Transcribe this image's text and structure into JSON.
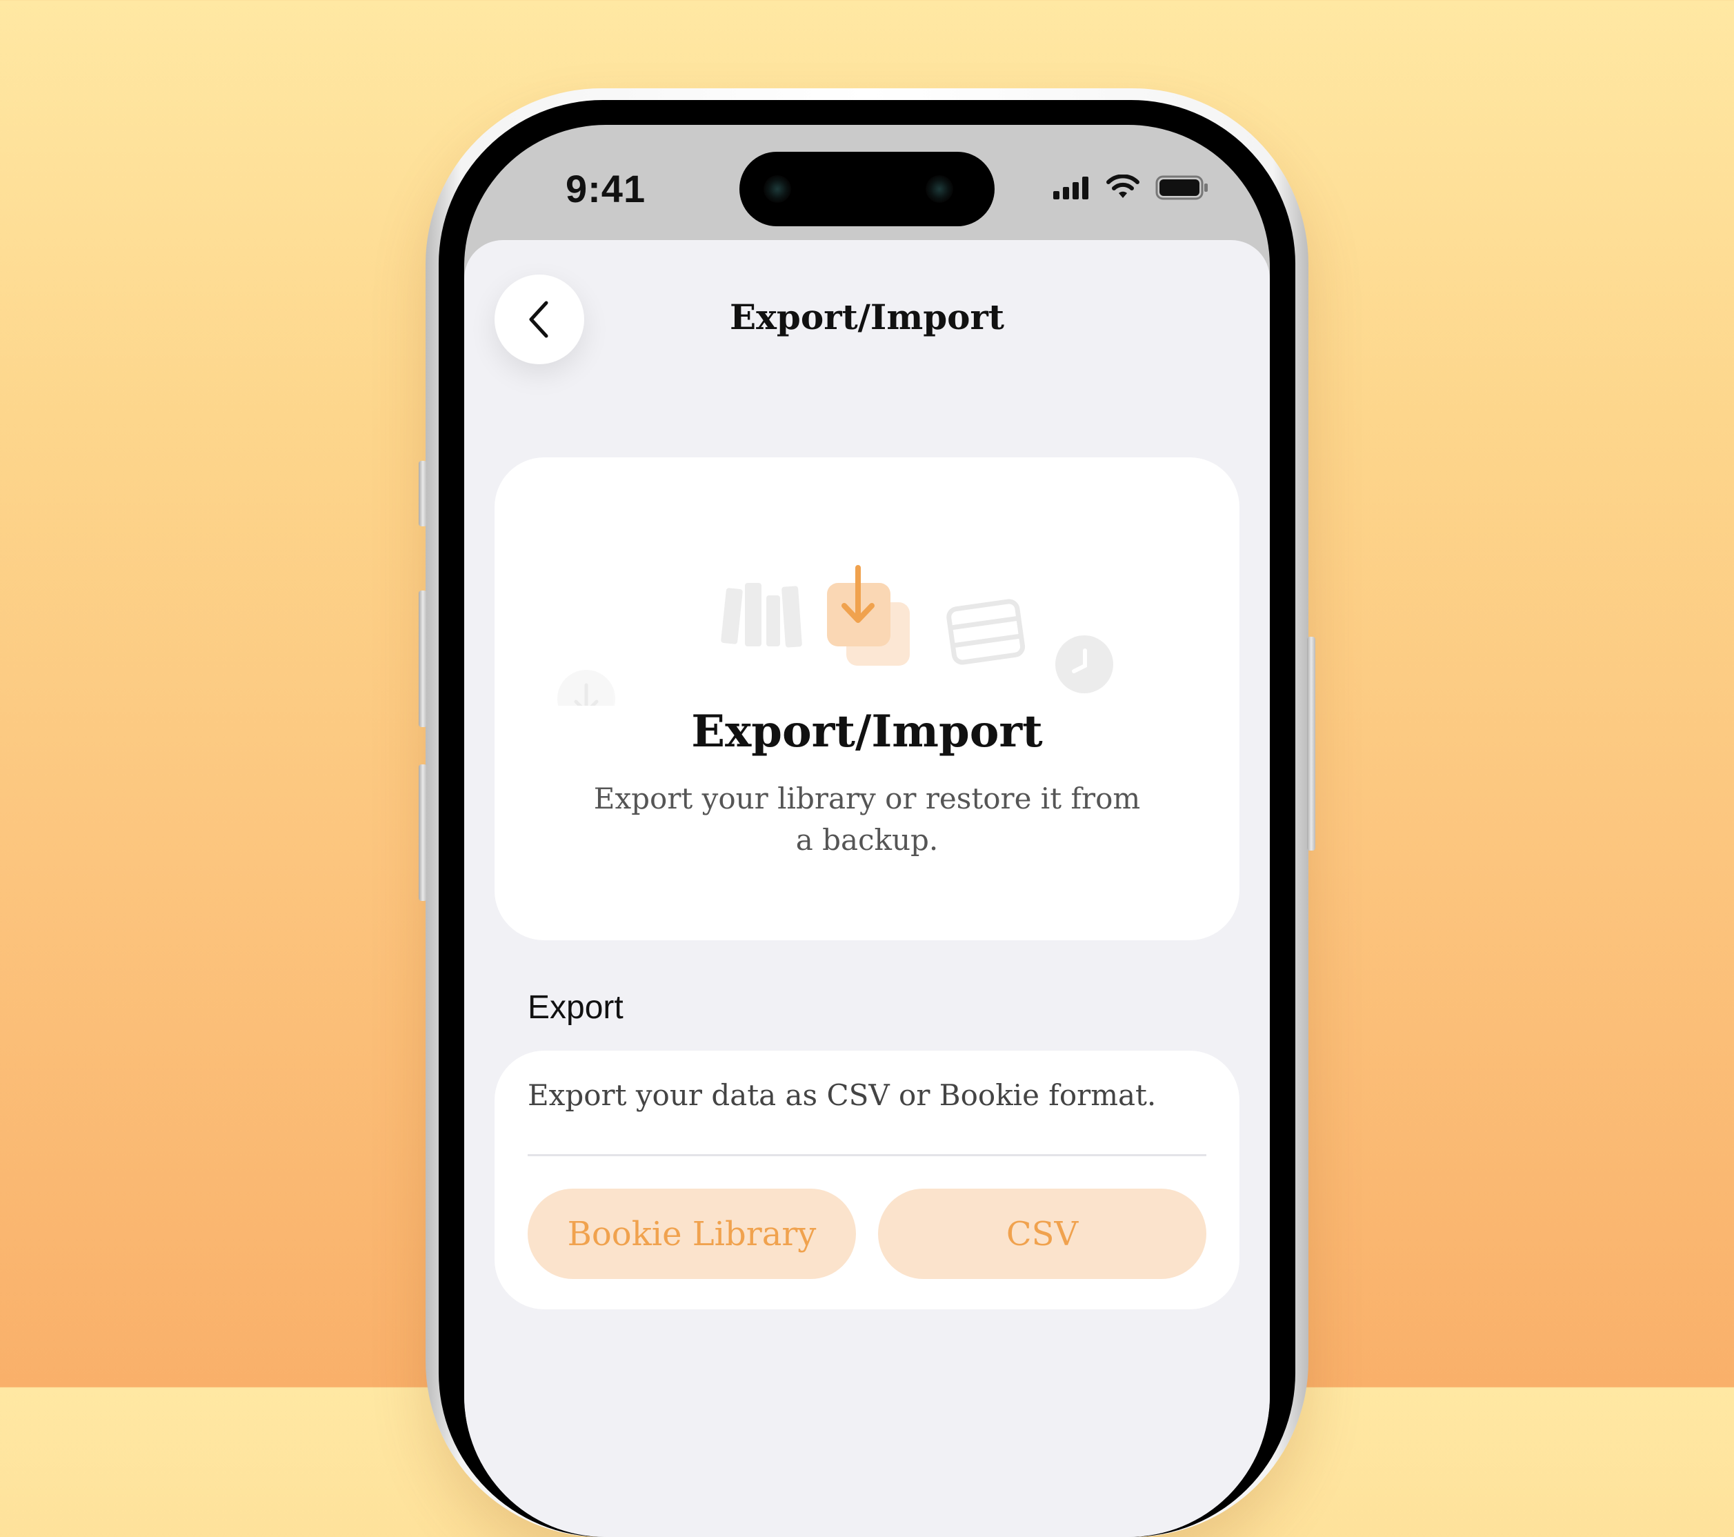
{
  "status_bar": {
    "time": "9:41"
  },
  "nav": {
    "title": "Export/Import"
  },
  "hero": {
    "title": "Export/Import",
    "subtitle_line1": "Export your library or restore it from",
    "subtitle_line2": "a backup."
  },
  "export_section": {
    "label": "Export",
    "description": "Export your data as CSV or Bookie format.",
    "buttons": [
      "Bookie Library",
      "CSV"
    ]
  },
  "colors": {
    "accent": "#F0A24E",
    "accent_light": "#FBE3CC",
    "sheet_background": "#F1F1F5",
    "card_background": "#FFFFFF"
  },
  "icons": [
    "back-chevron",
    "signal",
    "wifi",
    "battery",
    "books",
    "download-tray",
    "server",
    "clock",
    "down-arrow"
  ]
}
